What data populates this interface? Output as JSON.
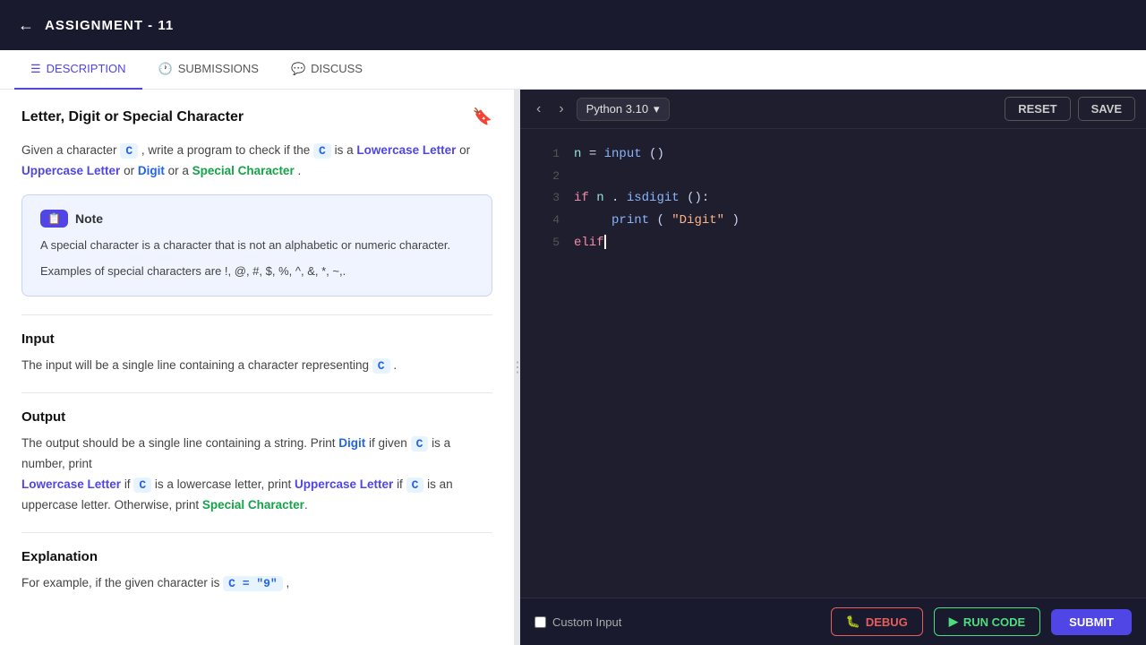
{
  "topbar": {
    "back_icon": "←",
    "title": "ASSIGNMENT - 11"
  },
  "tabs": [
    {
      "id": "description",
      "label": "DESCRIPTION",
      "icon": "☰",
      "active": true
    },
    {
      "id": "submissions",
      "label": "SUBMISSIONS",
      "icon": "🕐",
      "active": false
    },
    {
      "id": "discuss",
      "label": "DISCUSS",
      "icon": "💬",
      "active": false
    }
  ],
  "problem": {
    "title": "Letter, Digit or Special Character",
    "description_prefix": "Given a character",
    "c_var": "C",
    "description_middle": ", write a program to check if the",
    "c_var2": "C",
    "is_a": "is a",
    "lowercase_letter": "Lowercase Letter",
    "or1": "or",
    "uppercase_letter": "Uppercase Letter",
    "or2": "or",
    "digit": "Digit",
    "or_a": "or a",
    "special_character": "Special Character",
    "note": {
      "header": "Note",
      "text1": "A special character is a character that is not an alphabetic or numeric character.",
      "text2": "Examples of special characters are !, @, #, $, %, ^, &, *, ~,."
    },
    "input_section": {
      "title": "Input",
      "text_prefix": "The input will be a single line containing a character representing",
      "c_var": "C",
      "text_suffix": "."
    },
    "output_section": {
      "title": "Output",
      "text1": "The output should be a single line containing a string. Print",
      "digit_label": "Digit",
      "text2": "if given",
      "c1": "C",
      "text3": "is a number, print",
      "lowercase_label": "Lowercase Letter",
      "text4": "if",
      "c2": "C",
      "text5": "is a lowercase letter, print",
      "uppercase_label": "Uppercase Letter",
      "text6": "if",
      "c3": "C",
      "text7": "is an uppercase letter. Otherwise, print",
      "special_label": "Special Character",
      "text8": "."
    },
    "explanation_section": {
      "title": "Explanation",
      "text": "For example, if the given character is",
      "c_var": "C = \"9\"",
      "comma": ","
    }
  },
  "editor": {
    "language": "Python 3.10",
    "reset_label": "RESET",
    "save_label": "SAVE",
    "code_lines": [
      {
        "num": 1,
        "content": "n = input()"
      },
      {
        "num": 2,
        "content": ""
      },
      {
        "num": 3,
        "content": "if n.isdigit():"
      },
      {
        "num": 4,
        "content": "    print(\"Digit\")"
      },
      {
        "num": 5,
        "content": "elif"
      }
    ]
  },
  "bottom_bar": {
    "custom_input_label": "Custom Input",
    "debug_label": "DEBUG",
    "run_label": "RUN CODE",
    "submit_label": "SUBMIT",
    "debug_icon": "🐛",
    "run_icon": "▶"
  }
}
